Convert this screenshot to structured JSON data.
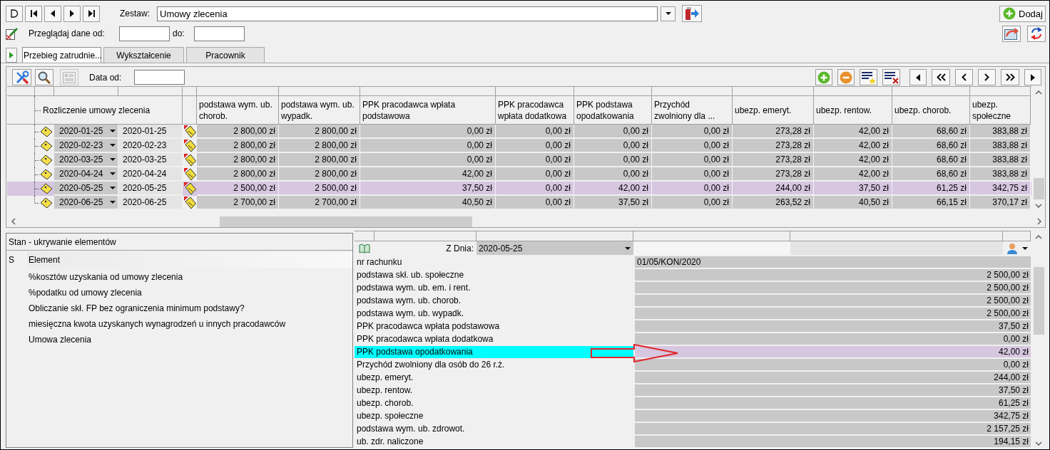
{
  "toolbar": {
    "set_label": "Zestaw:",
    "set_value": "Umowy zlecenia",
    "add_button": "Dodaj"
  },
  "filter": {
    "from_label": "Przeglądaj dane od:",
    "to_label": "do:"
  },
  "tabs": [
    {
      "label": "Przebieg zatrudnie...",
      "selected": true
    },
    {
      "label": "Wykształcenie",
      "selected": false
    },
    {
      "label": "Pracownik",
      "selected": false
    }
  ],
  "grid_toolbar": {
    "date_label": "Data od:",
    "calculator_disabled": true
  },
  "grid": {
    "tree_label": "Rozliczenie umowy zlecenia",
    "columns": [
      "podstawa wym. ub. chorob.",
      "podstawa wym. ub. wypadk.",
      "PPK pracodawca wpłata podstawowa",
      "PPK pracodawca wpłata dodatkowa",
      "PPK podstawa opodatkowania",
      "Przychód zwolniony dla ...",
      "ubezp. emeryt.",
      "ubezp. rentow.",
      "ubezp. chorob.",
      "ubezp. społeczne"
    ],
    "rows": [
      {
        "date": "2020-01-25",
        "date_2": "2020-01-25",
        "selected": false,
        "values": [
          "2 800,00 zł",
          "2 800,00 zł",
          "0,00 zł",
          "0,00 zł",
          "0,00 zł",
          "0,00 zł",
          "273,28 zł",
          "42,00 zł",
          "68,60 zł",
          "383,88 zł"
        ]
      },
      {
        "date": "2020-02-23",
        "date_2": "2020-02-23",
        "selected": false,
        "values": [
          "2 800,00 zł",
          "2 800,00 zł",
          "0,00 zł",
          "0,00 zł",
          "0,00 zł",
          "0,00 zł",
          "273,28 zł",
          "42,00 zł",
          "68,60 zł",
          "383,88 zł"
        ]
      },
      {
        "date": "2020-03-25",
        "date_2": "2020-03-25",
        "selected": false,
        "values": [
          "2 800,00 zł",
          "2 800,00 zł",
          "0,00 zł",
          "0,00 zł",
          "0,00 zł",
          "0,00 zł",
          "273,28 zł",
          "42,00 zł",
          "68,60 zł",
          "383,88 zł"
        ]
      },
      {
        "date": "2020-04-24",
        "date_2": "2020-04-24",
        "selected": false,
        "values": [
          "2 800,00 zł",
          "2 800,00 zł",
          "42,00 zł",
          "0,00 zł",
          "0,00 zł",
          "0,00 zł",
          "273,28 zł",
          "42,00 zł",
          "68,60 zł",
          "383,88 zł"
        ]
      },
      {
        "date": "2020-05-25",
        "date_2": "2020-05-25",
        "selected": true,
        "values": [
          "2 500,00 zł",
          "2 500,00 zł",
          "37,50 zł",
          "0,00 zł",
          "42,00 zł",
          "0,00 zł",
          "244,00 zł",
          "37,50 zł",
          "61,25 zł",
          "342,75 zł"
        ]
      },
      {
        "date": "2020-06-25",
        "date_2": "2020-06-25",
        "selected": false,
        "values": [
          "2 700,00 zł",
          "2 700,00 zł",
          "40,50 zł",
          "0,00 zł",
          "37,50 zł",
          "0,00 zł",
          "263,52 zł",
          "40,50 zł",
          "66,15 zł",
          "370,17 zł"
        ]
      }
    ]
  },
  "state_panel": {
    "title": "Stan - ukrywanie elementów",
    "columns": [
      "S",
      "Element"
    ],
    "items": [
      "%kosztów uzyskania od umowy zlecenia",
      "%podatku od umowy zlecenia",
      "Obliczanie skł. FP bez ograniczenia minimum podstawy?",
      "miesięczna kwota uzyskanych wynagrodzeń u innych pracodawców",
      "Umowa zlecenia"
    ]
  },
  "details": {
    "date_label": "Z Dnia:",
    "date": "2020-05-25",
    "rows": [
      {
        "label": "nr rachunku",
        "value": "01/05/KON/2020",
        "kind": "text",
        "selected": false
      },
      {
        "label": "podstawa skł. ub. społeczne",
        "value": "2 500,00 zł",
        "kind": "amount",
        "selected": false
      },
      {
        "label": "podstawa wym. ub. em. i rent.",
        "value": "2 500,00 zł",
        "kind": "amount",
        "selected": false
      },
      {
        "label": "podstawa wym. ub. chorob.",
        "value": "2 500,00 zł",
        "kind": "amount",
        "selected": false
      },
      {
        "label": "podstawa wym. ub. wypadk.",
        "value": "2 500,00 zł",
        "kind": "amount",
        "selected": false
      },
      {
        "label": "PPK pracodawca wpłata podstawowa",
        "value": "37,50 zł",
        "kind": "amount",
        "selected": false
      },
      {
        "label": "PPK pracodawca wpłata dodatkowa",
        "value": "0,00 zł",
        "kind": "amount",
        "selected": false
      },
      {
        "label": "PPK podstawa opodatkowania",
        "value": "42,00 zł",
        "kind": "amount",
        "selected": true
      },
      {
        "label": "Przychód zwolniony dla osób do 26 r.ż.",
        "value": "0,00 zł",
        "kind": "amount",
        "selected": false
      },
      {
        "label": "ubezp. emeryt.",
        "value": "244,00 zł",
        "kind": "amount",
        "selected": false
      },
      {
        "label": "ubezp. rentow.",
        "value": "37,50 zł",
        "kind": "amount",
        "selected": false
      },
      {
        "label": "ubezp. chorob.",
        "value": "61,25 zł",
        "kind": "amount",
        "selected": false
      },
      {
        "label": "ubezp. społeczne",
        "value": "342,75 zł",
        "kind": "amount",
        "selected": false
      },
      {
        "label": "podstawa wym. ub. zdrowot.",
        "value": "2 157,25 zł",
        "kind": "amount",
        "selected": false
      },
      {
        "label": "ub. zdr. naliczone",
        "value": "194,15 zł",
        "kind": "amount",
        "selected": false
      }
    ]
  }
}
